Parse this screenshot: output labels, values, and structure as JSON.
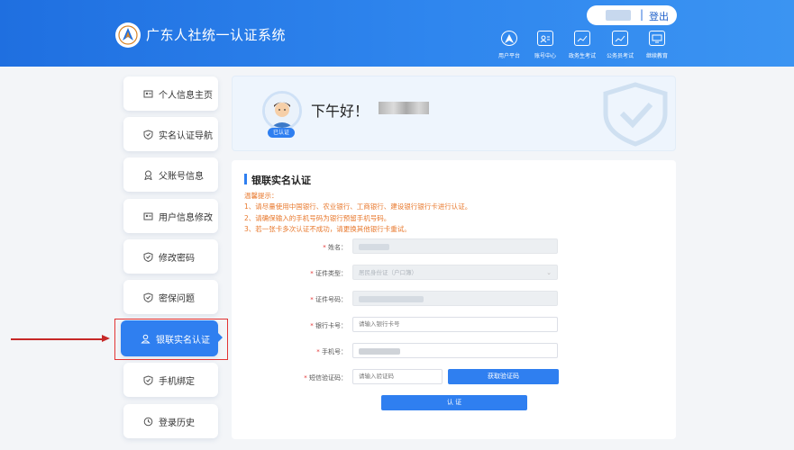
{
  "header": {
    "title": "广东人社统一认证系统",
    "logout": "登出",
    "nav": [
      "用户平台",
      "账号中心",
      "政务生考试",
      "公务员考试",
      "继续教育"
    ]
  },
  "sidebar": {
    "items": [
      "个人信息主页",
      "实名认证导航",
      "父账号信息",
      "用户信息修改",
      "修改密码",
      "密保问题",
      "银联实名认证",
      "手机绑定",
      "登录历史"
    ],
    "active_index": 6
  },
  "greeting": {
    "text": "下午好！",
    "badge": "已认证"
  },
  "form": {
    "section_title": "银联实名认证",
    "tips": [
      "温馨提示：",
      "1、请尽量使用中国银行、农业银行、工商银行、建设银行银行卡进行认证。",
      "2、请确保输入的手机号码为银行预留手机号码。",
      "3、若一张卡多次认证不成功，请更换其他银行卡重试。"
    ],
    "labels": {
      "name": "姓名：",
      "id_type": "证件类型：",
      "id_number": "证件号码：",
      "bank_card": "银行卡号：",
      "phone": "手机号：",
      "sms_code": "短信验证码："
    },
    "id_type_value": "居民身份证（户口簿）",
    "bank_card_placeholder": "请输入银行卡号",
    "sms_placeholder": "请输入验证码",
    "get_code_button": "获取验证码",
    "submit_button": "认 证"
  },
  "colors": {
    "header_gradient_start": "#1f6fe0",
    "header_gradient_end": "#3b94f2",
    "accent": "#2f7ff0",
    "tip_text": "#e8782c",
    "annotation_red": "#e23333"
  }
}
